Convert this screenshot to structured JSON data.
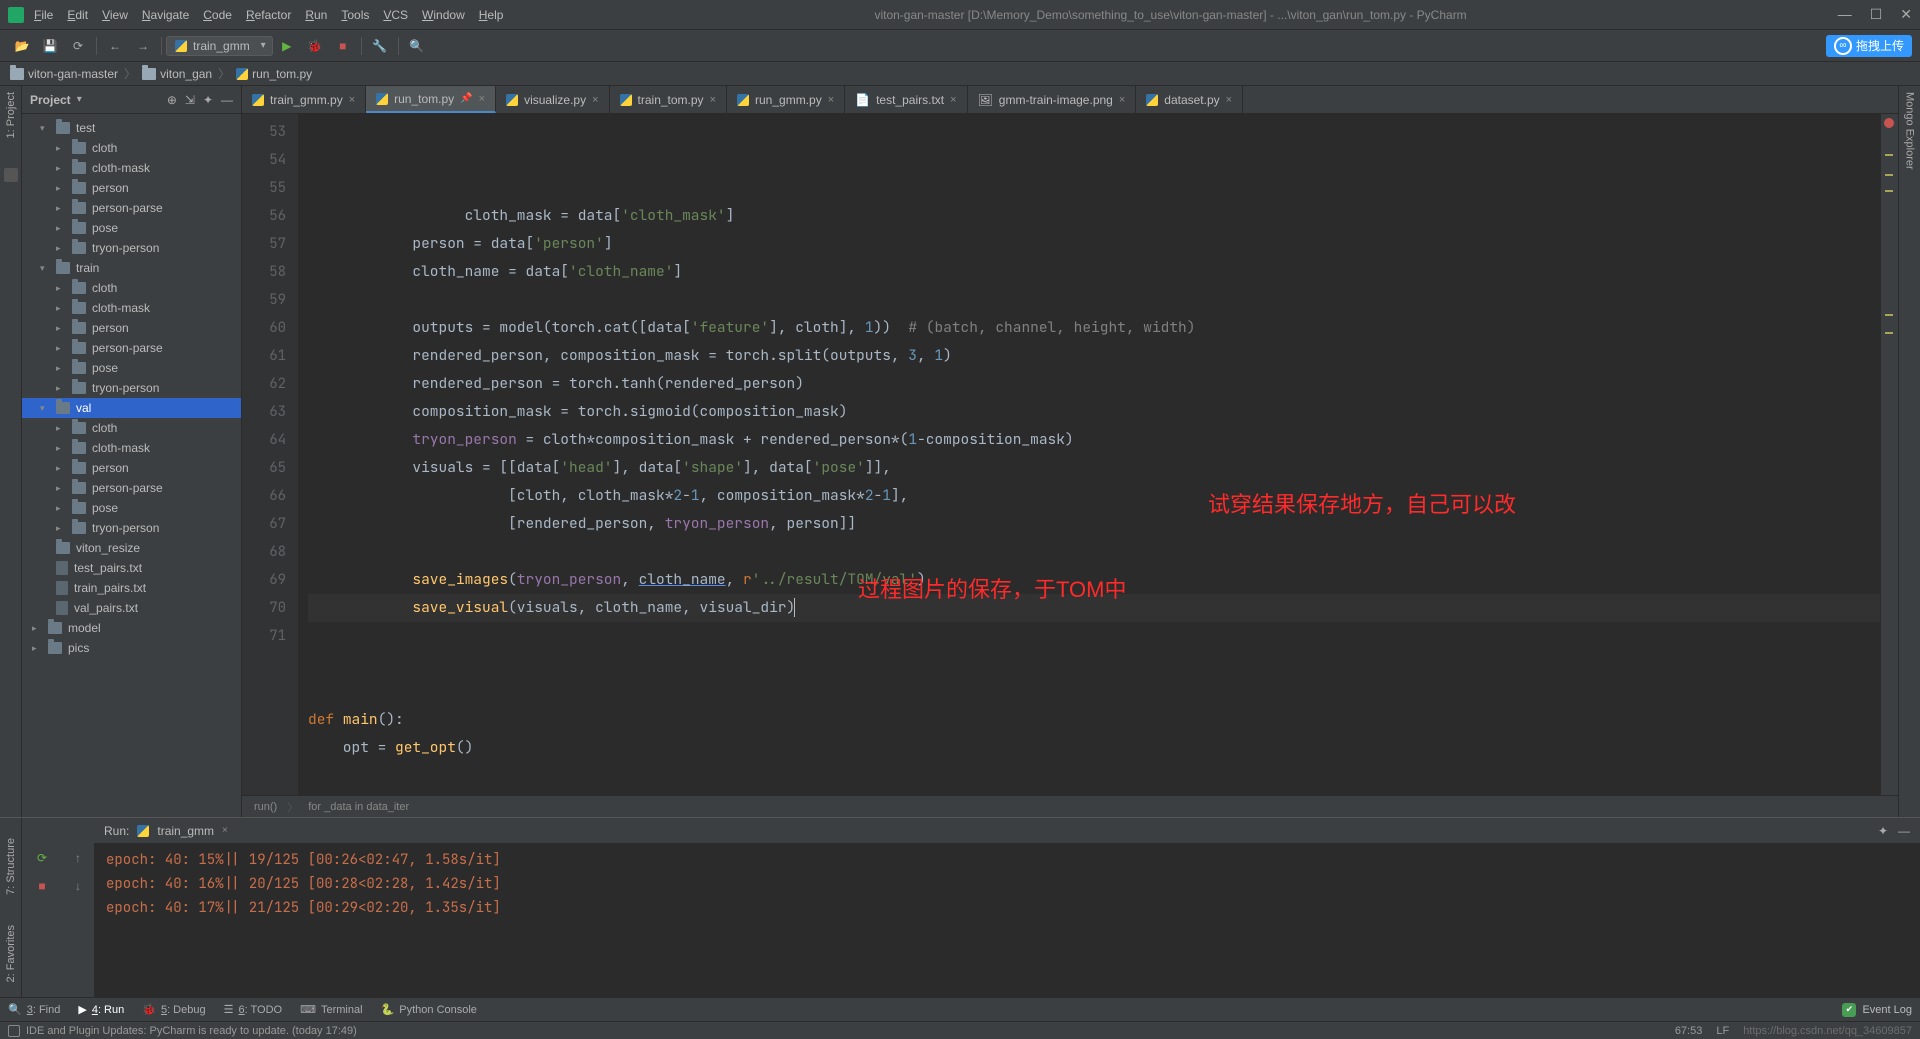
{
  "window": {
    "title": "viton-gan-master [D:\\Memory_Demo\\something_to_use\\viton-gan-master] - ...\\viton_gan\\run_tom.py - PyCharm"
  },
  "menus": [
    "File",
    "Edit",
    "View",
    "Navigate",
    "Code",
    "Refactor",
    "Run",
    "Tools",
    "VCS",
    "Window",
    "Help"
  ],
  "toolbar": {
    "run_config": "train_gmm",
    "cloud_label": "拖拽上传"
  },
  "breadcrumb": [
    {
      "icon": "folder",
      "label": "viton-gan-master"
    },
    {
      "icon": "folder",
      "label": "viton_gan"
    },
    {
      "icon": "py",
      "label": "run_tom.py"
    }
  ],
  "project": {
    "header": "Project",
    "items": [
      {
        "depth": 0,
        "arrow": "▾",
        "type": "dir",
        "label": "test"
      },
      {
        "depth": 1,
        "arrow": "▸",
        "type": "dir",
        "label": "cloth"
      },
      {
        "depth": 1,
        "arrow": "▸",
        "type": "dir",
        "label": "cloth-mask"
      },
      {
        "depth": 1,
        "arrow": "▸",
        "type": "dir",
        "label": "person"
      },
      {
        "depth": 1,
        "arrow": "▸",
        "type": "dir",
        "label": "person-parse"
      },
      {
        "depth": 1,
        "arrow": "▸",
        "type": "dir",
        "label": "pose"
      },
      {
        "depth": 1,
        "arrow": "▸",
        "type": "dir",
        "label": "tryon-person"
      },
      {
        "depth": 0,
        "arrow": "▾",
        "type": "dir",
        "label": "train"
      },
      {
        "depth": 1,
        "arrow": "▸",
        "type": "dir",
        "label": "cloth"
      },
      {
        "depth": 1,
        "arrow": "▸",
        "type": "dir",
        "label": "cloth-mask"
      },
      {
        "depth": 1,
        "arrow": "▸",
        "type": "dir",
        "label": "person"
      },
      {
        "depth": 1,
        "arrow": "▸",
        "type": "dir",
        "label": "person-parse"
      },
      {
        "depth": 1,
        "arrow": "▸",
        "type": "dir",
        "label": "pose"
      },
      {
        "depth": 1,
        "arrow": "▸",
        "type": "dir",
        "label": "tryon-person"
      },
      {
        "depth": 0,
        "arrow": "▾",
        "type": "dir",
        "label": "val",
        "selected": true
      },
      {
        "depth": 1,
        "arrow": "▸",
        "type": "dir",
        "label": "cloth"
      },
      {
        "depth": 1,
        "arrow": "▸",
        "type": "dir",
        "label": "cloth-mask"
      },
      {
        "depth": 1,
        "arrow": "▸",
        "type": "dir",
        "label": "person"
      },
      {
        "depth": 1,
        "arrow": "▸",
        "type": "dir",
        "label": "person-parse"
      },
      {
        "depth": 1,
        "arrow": "▸",
        "type": "dir",
        "label": "pose"
      },
      {
        "depth": 1,
        "arrow": "▸",
        "type": "dir",
        "label": "tryon-person"
      },
      {
        "depth": 0,
        "arrow": "",
        "type": "dir",
        "label": "viton_resize"
      },
      {
        "depth": 0,
        "arrow": "",
        "type": "file",
        "label": "test_pairs.txt"
      },
      {
        "depth": 0,
        "arrow": "",
        "type": "file",
        "label": "train_pairs.txt"
      },
      {
        "depth": 0,
        "arrow": "",
        "type": "file",
        "label": "val_pairs.txt"
      },
      {
        "depth": -1,
        "arrow": "▸",
        "type": "dir",
        "label": "model"
      },
      {
        "depth": -1,
        "arrow": "▸",
        "type": "dir",
        "label": "pics"
      }
    ]
  },
  "tabs": [
    {
      "label": "train_gmm.py",
      "pinned": false,
      "active": false
    },
    {
      "label": "run_tom.py",
      "pinned": true,
      "active": true
    },
    {
      "label": "visualize.py",
      "pinned": false,
      "active": false
    },
    {
      "label": "train_tom.py",
      "pinned": false,
      "active": false
    },
    {
      "label": "run_gmm.py",
      "pinned": false,
      "active": false
    },
    {
      "label": "test_pairs.txt",
      "pinned": false,
      "active": false,
      "txt": true
    },
    {
      "label": "gmm-train-image.png",
      "pinned": false,
      "active": false,
      "img": true
    },
    {
      "label": "dataset.py",
      "pinned": false,
      "active": false
    }
  ],
  "editor": {
    "first_line": 53,
    "lines": [
      "            cloth_mask = data['cloth_mask']",
      "            person = data['person']",
      "            cloth_name = data['cloth_name']",
      "",
      "            outputs = model(torch.cat([data['feature'], cloth], 1))  # (batch, channel, height, width)",
      "            rendered_person, composition_mask = torch.split(outputs, 3, 1)",
      "            rendered_person = torch.tanh(rendered_person)",
      "            composition_mask = torch.sigmoid(composition_mask)",
      "            tryon_person = cloth*composition_mask + rendered_person*(1-composition_mask)",
      "            visuals = [[data['head'], data['shape'], data['pose']],",
      "                       [cloth, cloth_mask*2-1, composition_mask*2-1],",
      "                       [rendered_person, tryon_person, person]]",
      "",
      "            save_images(tryon_person, cloth_name, r'../result/TOM/val')",
      "            save_visual(visuals, cloth_name, visual_dir)",
      "",
      "",
      "def main():",
      "    opt = get_opt()"
    ],
    "crumb_run": "run()",
    "crumb_loop": "for _data in data_iter",
    "annot1": "试穿结果保存地方，自己可以改",
    "annot2": "过程图片的保存，于TOM中"
  },
  "leftbar": {
    "project": "1: Project",
    "structure": "7: Structure",
    "favorites": "2: Favorites"
  },
  "rightbar": {
    "mongo": "Mongo Explorer"
  },
  "run": {
    "title_prefix": "Run:",
    "config": "train_gmm",
    "lines": [
      "epoch: 40:  15%|| 19/125 [00:26<02:47,  1.58s/it]",
      "epoch: 40:  16%|| 20/125 [00:28<02:28,  1.42s/it]",
      "epoch: 40:  17%|| 21/125 [00:29<02:20,  1.35s/it]"
    ]
  },
  "tooltabs": [
    {
      "icon": "search",
      "label": "3: Find"
    },
    {
      "icon": "run",
      "label": "4: Run",
      "active": true
    },
    {
      "icon": "bug",
      "label": "5: Debug"
    },
    {
      "icon": "todo",
      "label": "6: TODO"
    },
    {
      "icon": "term",
      "label": "Terminal"
    },
    {
      "icon": "py",
      "label": "Python Console"
    }
  ],
  "status": {
    "msg": "IDE and Plugin Updates: PyCharm is ready to update. (today 17:49)",
    "pos": "67:53",
    "le": "LF",
    "enc": "https://blog.csdn.net/qq_34609857",
    "event": "Event Log"
  }
}
